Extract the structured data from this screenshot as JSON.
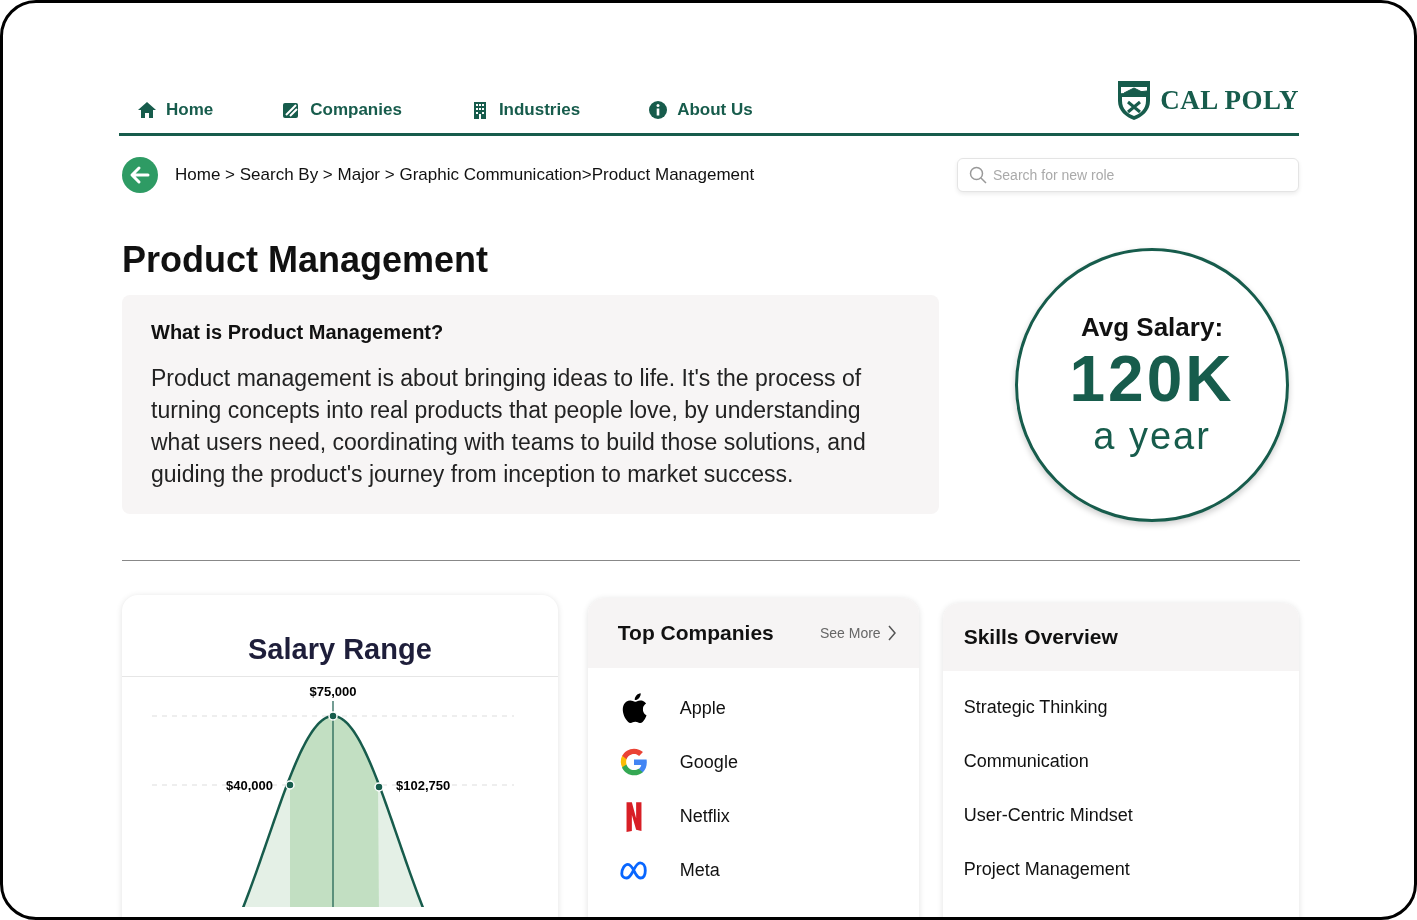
{
  "nav": {
    "items": [
      {
        "label": "Home",
        "kind": "home"
      },
      {
        "label": "Companies",
        "kind": "companies"
      },
      {
        "label": "Industries",
        "kind": "industries"
      },
      {
        "label": "About Us",
        "kind": "about"
      }
    ],
    "logo": "CAL POLY"
  },
  "breadcrumb": "Home > Search By > Major > Graphic Communication>Product Management",
  "search": {
    "placeholder": "Search for new role"
  },
  "title": "Product Management",
  "about": {
    "heading": "What is Product Management?",
    "text": "Product management is about bringing ideas to life. It's the process of turning concepts into real products that people love, by understanding what users need, coordinating with teams to build those solutions, and guiding the product's journey from inception to market success."
  },
  "salary": {
    "label": "Avg Salary:",
    "amount": "120K",
    "period": "a year"
  },
  "salary_range": {
    "title": "Salary Range",
    "peak": "$75,000",
    "low": "$40,000",
    "high": "$102,750"
  },
  "companies": {
    "title": "Top Companies",
    "see_more": "See More",
    "items": [
      {
        "name": "Apple",
        "kind": "apple"
      },
      {
        "name": "Google",
        "kind": "google"
      },
      {
        "name": "Netflix",
        "kind": "netflix"
      },
      {
        "name": "Meta",
        "kind": "meta"
      }
    ]
  },
  "skills": {
    "title": "Skills Overview",
    "items": [
      "Strategic Thinking",
      "Communication",
      "User-Centric Mindset",
      "Project Management"
    ]
  }
}
